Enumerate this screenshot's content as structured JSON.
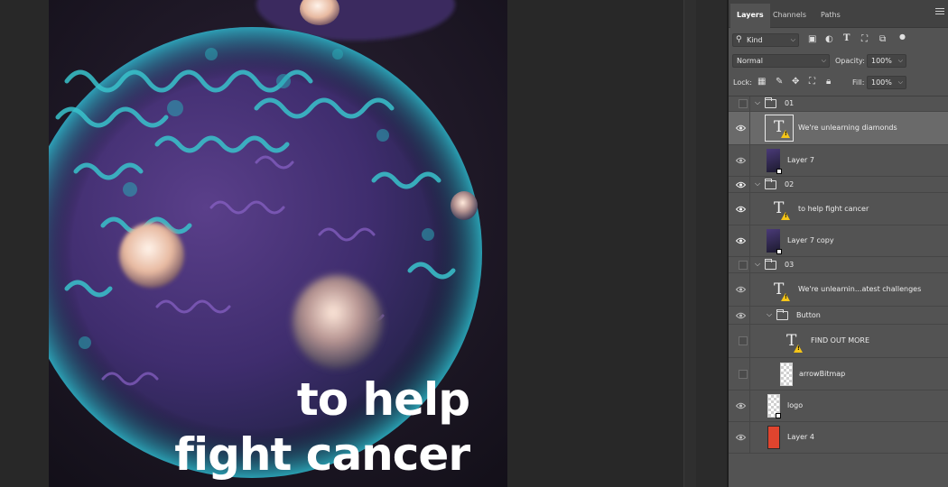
{
  "ad": {
    "line1": "to help",
    "line2": "fight cancer"
  },
  "panel": {
    "tabs": [
      {
        "label": "Layers",
        "active": true
      },
      {
        "label": "Channels",
        "active": false
      },
      {
        "label": "Paths",
        "active": false
      }
    ],
    "filter": {
      "value": "Kind"
    },
    "blend_mode": {
      "value": "Normal"
    },
    "opacity": {
      "label": "Opacity:",
      "value": "100%"
    },
    "lock": {
      "label": "Lock:"
    },
    "fill": {
      "label": "Fill:",
      "value": "100%"
    }
  },
  "layers": [
    {
      "name": "01",
      "type": "group",
      "visible": false,
      "expanded": true
    },
    {
      "name": "We're unlearning  diamonds",
      "type": "text",
      "visible": true,
      "selected": true,
      "warning": true
    },
    {
      "name": "Layer 7",
      "type": "image",
      "visible": true,
      "smart": true
    },
    {
      "name": "02",
      "type": "group",
      "visible": true,
      "expanded": true
    },
    {
      "name": "to help fight cancer",
      "type": "text",
      "visible": true,
      "warning": true
    },
    {
      "name": "Layer 7 copy",
      "type": "image",
      "visible": true,
      "smart": true
    },
    {
      "name": "03",
      "type": "group",
      "visible": false,
      "expanded": true
    },
    {
      "name": "We're  unlearnin...atest challenges",
      "type": "text",
      "visible": true,
      "warning": true
    },
    {
      "name": "Button",
      "type": "group",
      "visible": true,
      "expanded": true
    },
    {
      "name": "FIND OUT MORE",
      "type": "text",
      "visible": false,
      "warning": true
    },
    {
      "name": "arrowBitmap",
      "type": "transparent",
      "visible": false
    },
    {
      "name": "logo",
      "type": "transparent",
      "visible": true,
      "smart": true
    },
    {
      "name": "Layer 4",
      "type": "color",
      "visible": true,
      "color": "#e0442e"
    }
  ],
  "colors": {
    "panel_bg": "#535353",
    "selected_row": "#6a6a6a",
    "warning": "#f5c518",
    "layer4_swatch": "#e0442e"
  }
}
